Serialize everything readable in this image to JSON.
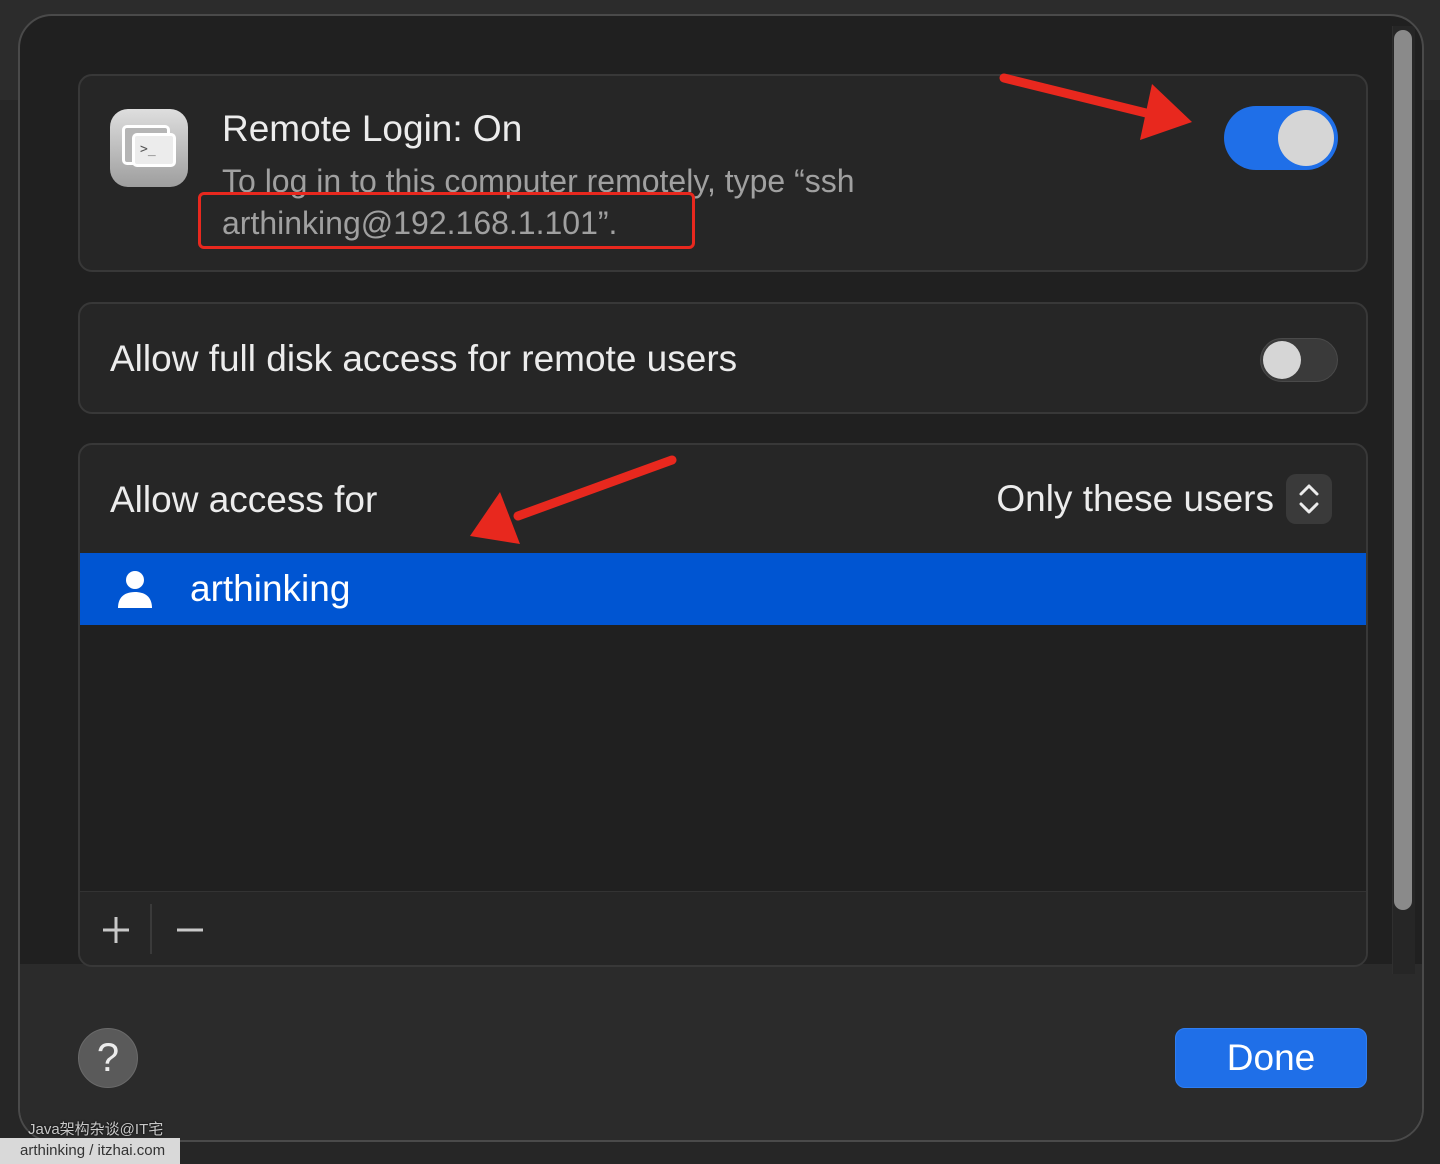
{
  "remote_login": {
    "title": "Remote Login: On",
    "description": "To log in to this computer remotely, type “ssh arthinking@192.168.1.101”.",
    "enabled": true,
    "app_icon": "terminal-window-icon"
  },
  "full_disk_access": {
    "label": "Allow full disk access for remote users",
    "enabled": false
  },
  "allow_access": {
    "label": "Allow access for",
    "selected": "Only these users",
    "users": [
      {
        "name": "arthinking",
        "icon": "person-icon",
        "selected": true
      }
    ],
    "add_label": "+",
    "remove_label": "−"
  },
  "footer": {
    "help_label": "?",
    "done_label": "Done"
  },
  "annotations": {
    "accent_color": "#e8281e"
  },
  "watermark": "Java架构杂谈@IT宅",
  "attribution": "arthinking / itzhai.com",
  "colors": {
    "toggle_on": "#1f6fe8",
    "selection": "#0055d2",
    "done_button": "#1f6fe8"
  }
}
